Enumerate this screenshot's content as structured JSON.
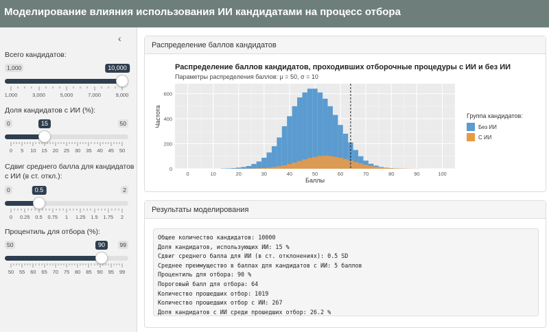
{
  "header": {
    "title": "Моделирование влияния использования ИИ кандидатами на процесс отбора"
  },
  "sidebar": {
    "collapse_icon": "‹",
    "sliders": [
      {
        "label": "Всего кандидатов:",
        "min_label": "1,000",
        "max_label": "10,000",
        "value_label": "10,000",
        "fraction": 1.0,
        "ticks": [
          "1,000",
          "3,000",
          "5,000",
          "7,000",
          "9,000"
        ]
      },
      {
        "label": "Доля кандидатов с ИИ (%):",
        "min_label": "0",
        "max_label": "50",
        "value_label": "15",
        "fraction": 0.3,
        "ticks": [
          "0",
          "5",
          "10",
          "15",
          "20",
          "25",
          "30",
          "35",
          "40",
          "45",
          "50"
        ]
      },
      {
        "label": "Сдвиг среднего балла для кандидатов",
        "label2": "с ИИ (в ст. откл.):",
        "min_label": "0",
        "max_label": "2",
        "value_label": "0.5",
        "fraction": 0.25,
        "ticks": [
          "0",
          "0.25",
          "0.5",
          "0.75",
          "1",
          "1.25",
          "1.5",
          "1.75",
          "2"
        ]
      },
      {
        "label": "Процентиль для отбора (%):",
        "min_label": "50",
        "max_label": "99",
        "value_label": "90",
        "fraction": 0.8163,
        "ticks": [
          "50",
          "55",
          "60",
          "65",
          "70",
          "75",
          "80",
          "85",
          "90",
          "95",
          "99"
        ]
      }
    ]
  },
  "chart_panel": {
    "title": "Распределение баллов кандидатов"
  },
  "results_panel": {
    "title": "Результаты моделирования",
    "lines": [
      "Общее количество кандидатов: 10000",
      "Доля кандидатов, использующих ИИ: 15 %",
      "Сдвиг среднего балла для ИИ (в ст. отклонениях): 0.5 SD",
      "Среднее преимущество в баллах для кандидатов с ИИ: 5 баллов",
      "Процентиль для отбора: 90 %",
      "Пороговый балл для отбора: 64",
      "Количество прошедших отбор: 1019",
      "Количество прошедших отбор с ИИ: 267",
      "Доля кандидатов с ИИ среди прошедших отбор: 26.2 %"
    ]
  },
  "colors": {
    "no_ai": "#5b9bd0",
    "ai": "#ea9a45",
    "accent": "#2e3e4e"
  },
  "chart_data": {
    "type": "bar",
    "title": "Распределение баллов кандидатов, проходивших отборочные процедуры с ИИ и без ИИ",
    "subtitle": "Параметры распределения баллов: μ = 50, σ = 10",
    "xlabel": "Баллы",
    "ylabel": "Частота",
    "xlim": [
      -5,
      105
    ],
    "ylim": [
      0,
      680
    ],
    "x_ticks": [
      0,
      10,
      20,
      30,
      40,
      50,
      60,
      70,
      80,
      90,
      100
    ],
    "y_ticks": [
      0,
      200,
      400,
      600
    ],
    "bin_width": 2,
    "threshold": 64,
    "grid": true,
    "legend_title": "Группа кандидатов:",
    "legend_position": "right",
    "series": [
      {
        "name": "Без ИИ",
        "color": "#5b9bd0",
        "x": [
          14,
          16,
          18,
          20,
          22,
          24,
          26,
          28,
          30,
          32,
          34,
          36,
          38,
          40,
          42,
          44,
          46,
          48,
          50,
          52,
          54,
          56,
          58,
          60,
          62,
          64,
          66,
          68,
          70,
          72,
          74,
          76,
          78,
          80,
          82,
          84,
          86
        ],
        "values": [
          2,
          3,
          5,
          9,
          14,
          22,
          38,
          58,
          88,
          130,
          180,
          250,
          340,
          420,
          500,
          570,
          610,
          640,
          640,
          610,
          560,
          500,
          430,
          350,
          280,
          210,
          150,
          100,
          65,
          40,
          25,
          14,
          8,
          5,
          3,
          2,
          1
        ]
      },
      {
        "name": "С ИИ",
        "color": "#ea9a45",
        "x": [
          20,
          22,
          24,
          26,
          28,
          30,
          32,
          34,
          36,
          38,
          40,
          42,
          44,
          46,
          48,
          50,
          52,
          54,
          56,
          58,
          60,
          62,
          64,
          66,
          68,
          70,
          72,
          74,
          76,
          78,
          80,
          82,
          84,
          86,
          88,
          90
        ],
        "values": [
          1,
          1,
          2,
          3,
          4,
          6,
          9,
          14,
          20,
          28,
          38,
          50,
          62,
          75,
          86,
          95,
          102,
          105,
          102,
          96,
          88,
          78,
          66,
          54,
          42,
          32,
          23,
          16,
          10,
          6,
          4,
          3,
          2,
          1,
          1,
          1
        ]
      }
    ]
  }
}
